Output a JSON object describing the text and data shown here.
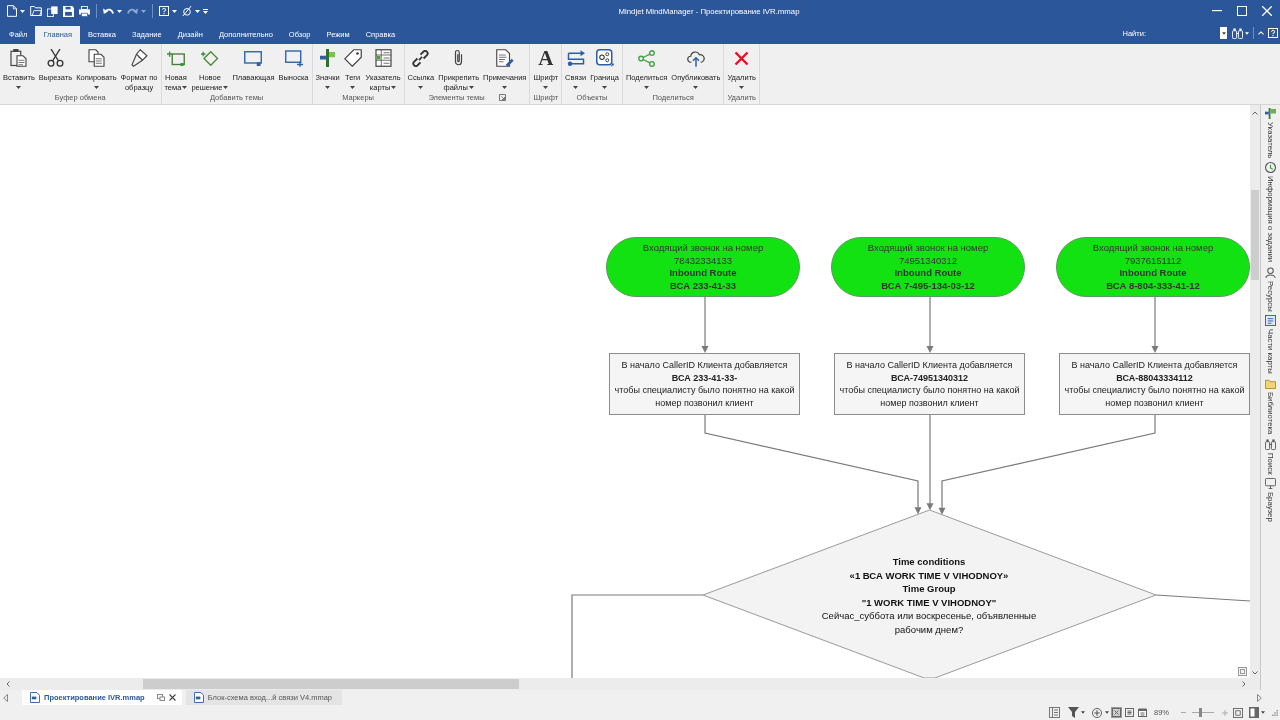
{
  "window": {
    "title": "Mindjet MindManager - Проектирование IVR.mmap"
  },
  "ribbon": {
    "tabs": [
      {
        "label": "Файл",
        "selected": false
      },
      {
        "label": "Главная",
        "selected": true
      },
      {
        "label": "Вставка",
        "selected": false
      },
      {
        "label": "Задание",
        "selected": false
      },
      {
        "label": "Дизайн",
        "selected": false
      },
      {
        "label": "Дополнительно",
        "selected": false
      },
      {
        "label": "Обзор",
        "selected": false
      },
      {
        "label": "Режим",
        "selected": false
      },
      {
        "label": "Справка",
        "selected": false
      }
    ],
    "find": {
      "label": "Найти:"
    },
    "groups": [
      {
        "label": "Буфер обмена",
        "buttons": [
          {
            "label": "Вставить",
            "dropdown": true
          },
          {
            "label": "Вырезать",
            "dropdown": false
          },
          {
            "label": "Копировать",
            "dropdown": true
          },
          {
            "label": "Формат по\nобразцу",
            "dropdown": false
          }
        ]
      },
      {
        "label": "Добавить темы",
        "buttons": [
          {
            "label": "Новая\nтема",
            "dropdown": true
          },
          {
            "label": "Новое\nрешение",
            "dropdown": true
          },
          {
            "label": "Плавающая",
            "dropdown": false
          },
          {
            "label": "Выноска",
            "dropdown": false
          }
        ]
      },
      {
        "label": "Маркеры",
        "buttons": [
          {
            "label": "Значки",
            "dropdown": true
          },
          {
            "label": "Теги",
            "dropdown": true
          },
          {
            "label": "Указатель\nкарты",
            "dropdown": true
          }
        ]
      },
      {
        "label": "Элементы темы",
        "launcher": true,
        "buttons": [
          {
            "label": "Ссылка",
            "dropdown": true
          },
          {
            "label": "Прикрепить\nфайлы",
            "dropdown": true
          },
          {
            "label": "Примечания",
            "dropdown": true
          }
        ]
      },
      {
        "label": "Шрифт",
        "buttons": [
          {
            "label": "Шрифт",
            "glyph": "A",
            "dropdown": true
          }
        ]
      },
      {
        "label": "Объекты",
        "buttons": [
          {
            "label": "Связи",
            "dropdown": true
          },
          {
            "label": "Граница",
            "dropdown": true
          }
        ]
      },
      {
        "label": "Поделиться",
        "buttons": [
          {
            "label": "Поделиться",
            "dropdown": true
          },
          {
            "label": "Опубликовать",
            "dropdown": true
          }
        ]
      },
      {
        "label": "Удалить",
        "buttons": [
          {
            "label": "Удалить",
            "dropdown": true
          }
        ]
      }
    ]
  },
  "map": {
    "route_nodes": [
      {
        "text": "Входящий звонок на номер\n78432334133\n**Inbound Route**\n**ВСА 233-41-33**"
      },
      {
        "text": "Входящий звонок на номер\n74951340312\n**Inbound Route**\n**ВСА 7-495-134-03-12**"
      },
      {
        "text": "Входящий звонок на номер\n79376151112\n**Inbound Route**\n**ВСА 8-804-333-41-12**"
      }
    ],
    "callerid_nodes": [
      {
        "text": "В начало CallerID Клиента добавляется\n**ВСА 233-41-33-**\nчтобы специалисту было понятно на какой\nномер позвонил клиент"
      },
      {
        "text": "В начало CallerID Клиента добавляется\n**ВСА-74951340312**\nчтобы специалисту было понятно на какой\nномер позвонил клиент"
      },
      {
        "text": "В начало CallerID Клиента добавляется\n**ВСА-88043334112**\nчтобы специалисту было понятно на какой\nномер позвонил клиент"
      }
    ],
    "decision": {
      "text": "**Time conditions**\n**«1 ВСА WORK TIME V VIHODNOY»**\n**Time Group**\n**\"1 WORK TIME V VIHODNOY\"**\nСейчас_суббота или воскресенье, объявленные\nрабочим днем?"
    }
  },
  "side_panel": {
    "tabs": [
      "Указатель",
      "Информация о задании",
      "Ресурсы",
      "Части карты",
      "Библиотека",
      "Поиск",
      "Браузер"
    ]
  },
  "document_tabs": [
    {
      "label": "Проектирование IVR.mmap",
      "selected": true
    },
    {
      "label": "Блок-схема вход...й связи V4.mmap",
      "selected": false
    }
  ],
  "status_bar": {
    "view_toggles": [
      {
        "selected": true
      },
      {
        "selected": false
      },
      {
        "selected": false
      }
    ],
    "zoom": {
      "reading": "89%",
      "level": 0.4
    }
  }
}
